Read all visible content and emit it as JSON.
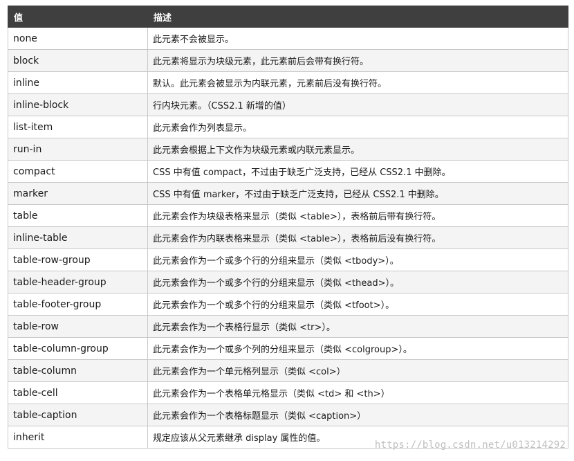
{
  "table": {
    "headers": [
      "值",
      "描述"
    ],
    "rows": [
      [
        "none",
        "此元素不会被显示。"
      ],
      [
        "block",
        "此元素将显示为块级元素，此元素前后会带有换行符。"
      ],
      [
        "inline",
        "默认。此元素会被显示为内联元素，元素前后没有换行符。"
      ],
      [
        "inline-block",
        "行内块元素。（CSS2.1 新增的值）"
      ],
      [
        "list-item",
        "此元素会作为列表显示。"
      ],
      [
        "run-in",
        "此元素会根据上下文作为块级元素或内联元素显示。"
      ],
      [
        "compact",
        "CSS 中有值 compact，不过由于缺乏广泛支持，已经从 CSS2.1 中删除。"
      ],
      [
        "marker",
        "CSS 中有值 marker，不过由于缺乏广泛支持，已经从 CSS2.1 中删除。"
      ],
      [
        "table",
        "此元素会作为块级表格来显示（类似 <table>），表格前后带有换行符。"
      ],
      [
        "inline-table",
        "此元素会作为内联表格来显示（类似 <table>），表格前后没有换行符。"
      ],
      [
        "table-row-group",
        "此元素会作为一个或多个行的分组来显示（类似 <tbody>）。"
      ],
      [
        "table-header-group",
        "此元素会作为一个或多个行的分组来显示（类似 <thead>）。"
      ],
      [
        "table-footer-group",
        "此元素会作为一个或多个行的分组来显示（类似 <tfoot>）。"
      ],
      [
        "table-row",
        "此元素会作为一个表格行显示（类似 <tr>）。"
      ],
      [
        "table-column-group",
        "此元素会作为一个或多个列的分组来显示（类似 <colgroup>）。"
      ],
      [
        "table-column",
        "此元素会作为一个单元格列显示（类似 <col>）"
      ],
      [
        "table-cell",
        "此元素会作为一个表格单元格显示（类似 <td> 和 <th>）"
      ],
      [
        "table-caption",
        "此元素会作为一个表格标题显示（类似 <caption>）"
      ],
      [
        "inherit",
        "规定应该从父元素继承 display 属性的值。"
      ]
    ]
  },
  "watermark": "https://blog.csdn.net/u013214292"
}
